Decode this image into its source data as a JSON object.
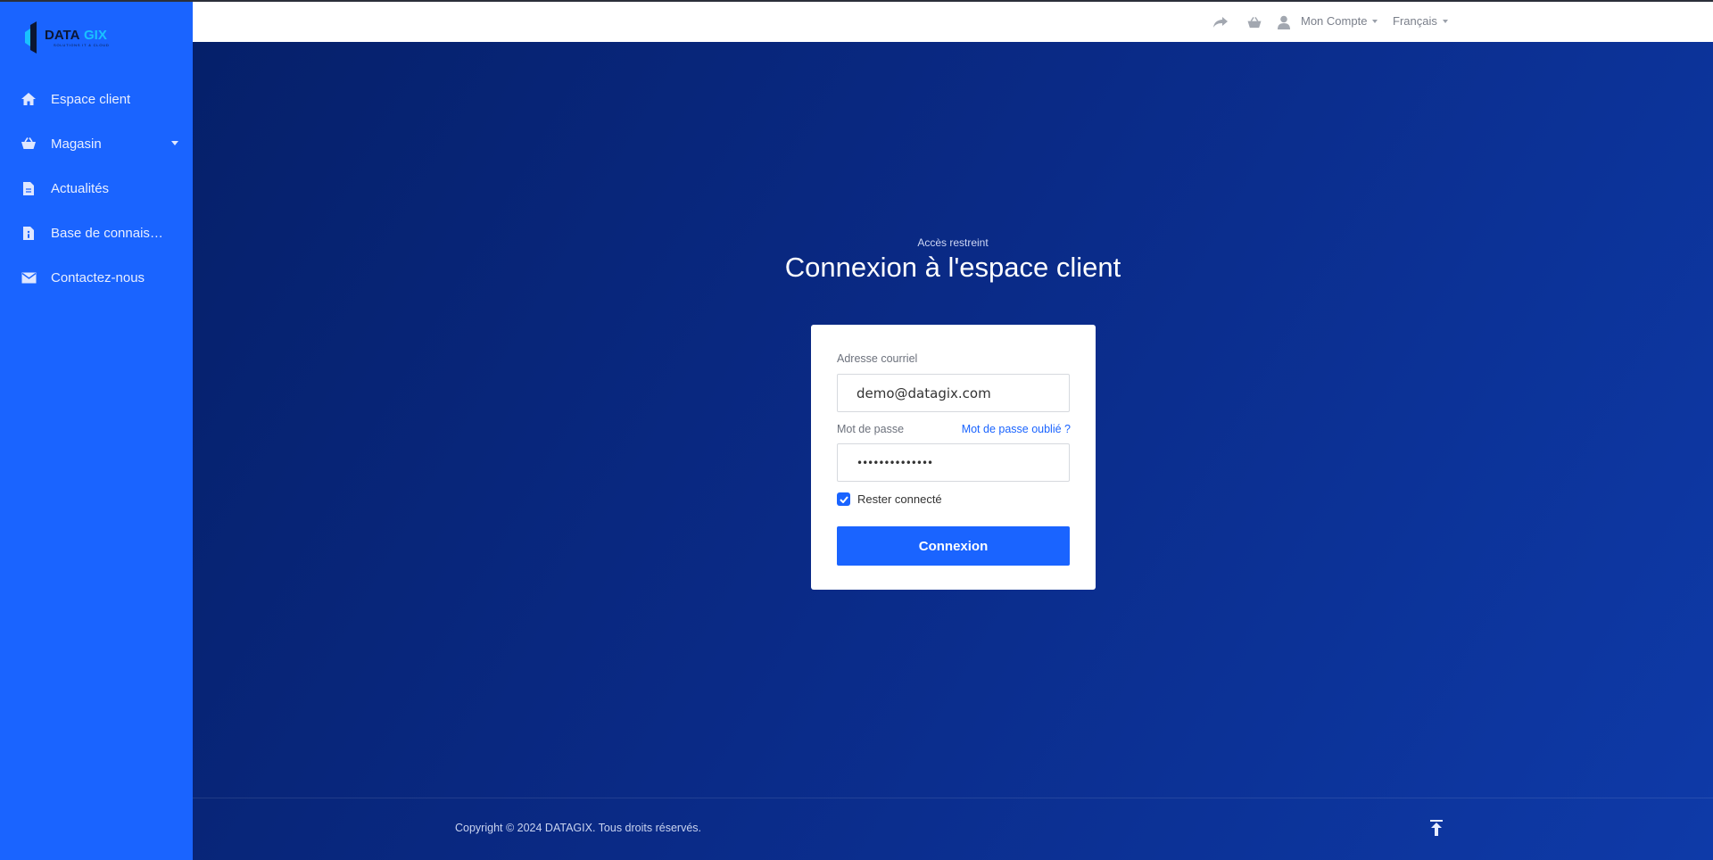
{
  "brand": {
    "logo_text": "DATAGIX",
    "tagline": "SOLUTIONS IT & CLOUD"
  },
  "sidebar": {
    "items": [
      {
        "label": "Espace client",
        "icon": "home-icon"
      },
      {
        "label": "Magasin",
        "icon": "basket-icon",
        "has_submenu": true
      },
      {
        "label": "Actualités",
        "icon": "document-icon"
      },
      {
        "label": "Base de connaissances",
        "icon": "info-file-icon"
      },
      {
        "label": "Contactez-nous",
        "icon": "envelope-icon"
      }
    ]
  },
  "header": {
    "share_icon": "share-icon",
    "cart_icon": "basket-icon",
    "account_label": "Mon Compte",
    "language_label": "Français"
  },
  "login": {
    "kicker": "Accès restreint",
    "title": "Connexion à l'espace client",
    "email_label": "Adresse courriel",
    "email_value": "demo@datagix.com",
    "password_label": "Mot de passe",
    "password_value": "••••••••••••••",
    "forgot_label": "Mot de passe oublié ?",
    "remember_label": "Rester connecté",
    "remember_checked": true,
    "submit_label": "Connexion"
  },
  "footer": {
    "copyright": "Copyright © 2024 DATAGIX. Tous droits réservés."
  },
  "colors": {
    "accent": "#1a64ff",
    "background_dark": "#0a2a86",
    "card": "#ffffff"
  }
}
